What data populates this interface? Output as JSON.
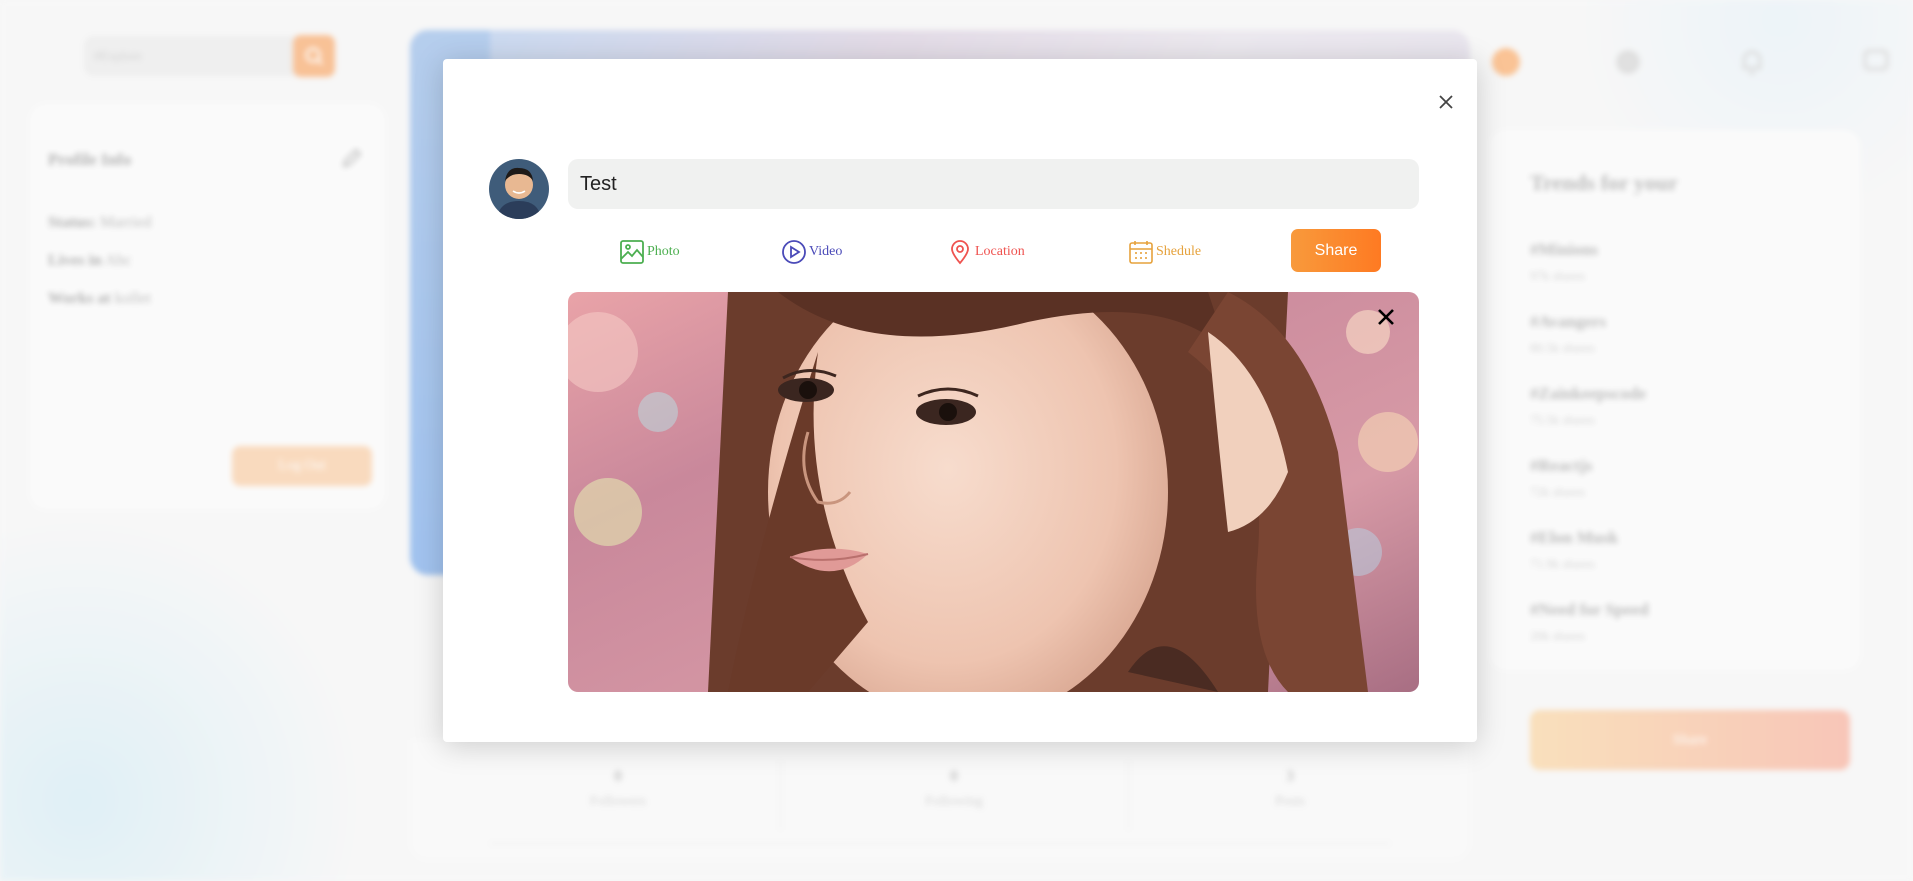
{
  "background": {
    "search": {
      "placeholder": "#Explore"
    },
    "profile_info": {
      "title": "Profile Info",
      "rows": [
        {
          "label": "Status:",
          "value": "Married"
        },
        {
          "label": "Lives in",
          "value": "Abc"
        },
        {
          "label": "Works at",
          "value": "kollet"
        }
      ],
      "logout_label": "Log Out"
    },
    "stats": [
      {
        "value": "0",
        "label": "Followers"
      },
      {
        "value": "0",
        "label": "Following"
      },
      {
        "value": "3",
        "label": "Posts"
      }
    ],
    "trends": {
      "title": "Trends for your",
      "items": [
        {
          "tag": "#Minions",
          "shares": "97k shares"
        },
        {
          "tag": "#Avangers",
          "shares": "80.5k shares"
        },
        {
          "tag": "#Zainkeepscode",
          "shares": "75.5k shares"
        },
        {
          "tag": "#Reactjs",
          "shares": "72k shares"
        },
        {
          "tag": "#Elon Musk",
          "shares": "71.9k shares"
        },
        {
          "tag": "#Need for Speed",
          "shares": "20k shares"
        }
      ]
    },
    "share_label": "Share"
  },
  "modal": {
    "input_value": "Test",
    "options": {
      "photo": "Photo",
      "video": "Video",
      "location": "Location",
      "schedule": "Shedule"
    },
    "share_label": "Share",
    "colors": {
      "photo": "#4caf50",
      "video": "#4a4ab8",
      "location": "#ef5350",
      "schedule": "#e6a23c",
      "share": "#fe7a22"
    }
  }
}
